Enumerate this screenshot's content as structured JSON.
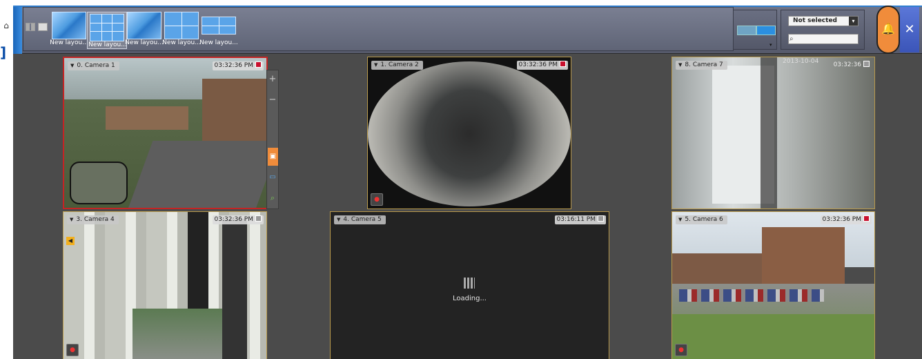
{
  "toolbar": {
    "layouts": [
      {
        "label": "New layou...",
        "style": "plain",
        "active": false
      },
      {
        "label": "New layou...",
        "style": "grid9",
        "active": true
      },
      {
        "label": "New layou...",
        "style": "plain",
        "active": false
      },
      {
        "label": "New layou...",
        "style": "grid4",
        "active": false
      },
      {
        "label": "New layou...",
        "style": "wide",
        "active": false
      }
    ],
    "filter": {
      "selected": "Not selected"
    },
    "search": {
      "placeholder": ""
    }
  },
  "workspace": {
    "cameras": [
      {
        "title": "0. Camera 1",
        "time": "03:32:36 PM",
        "recording": true
      },
      {
        "title": "1. Camera 2",
        "time": "03:32:36 PM",
        "recording": true
      },
      {
        "title": "8. Camera 7",
        "time": "03:32:36",
        "overlay_date": "2013-10-04",
        "recording": false
      },
      {
        "title": "3. Camera 4",
        "time": "03:32:36 PM",
        "recording": false
      },
      {
        "title": "4. Camera 5",
        "time": "03:16:11 PM",
        "recording": false,
        "status": "Loading..."
      },
      {
        "title": "5. Camera 6",
        "time": "03:32:36 PM",
        "recording": true
      }
    ]
  },
  "colors": {
    "accent_orange": "#f08c3b",
    "selected_border": "#c42424",
    "tile_border": "#b99a4c",
    "toolbar_blue": "#2f7fd0"
  },
  "icons": [
    "home-icon",
    "layout-grid-icon",
    "bell-icon",
    "tools-icon",
    "search-icon",
    "zoom-in-icon",
    "zoom-out-icon",
    "record-icon"
  ]
}
